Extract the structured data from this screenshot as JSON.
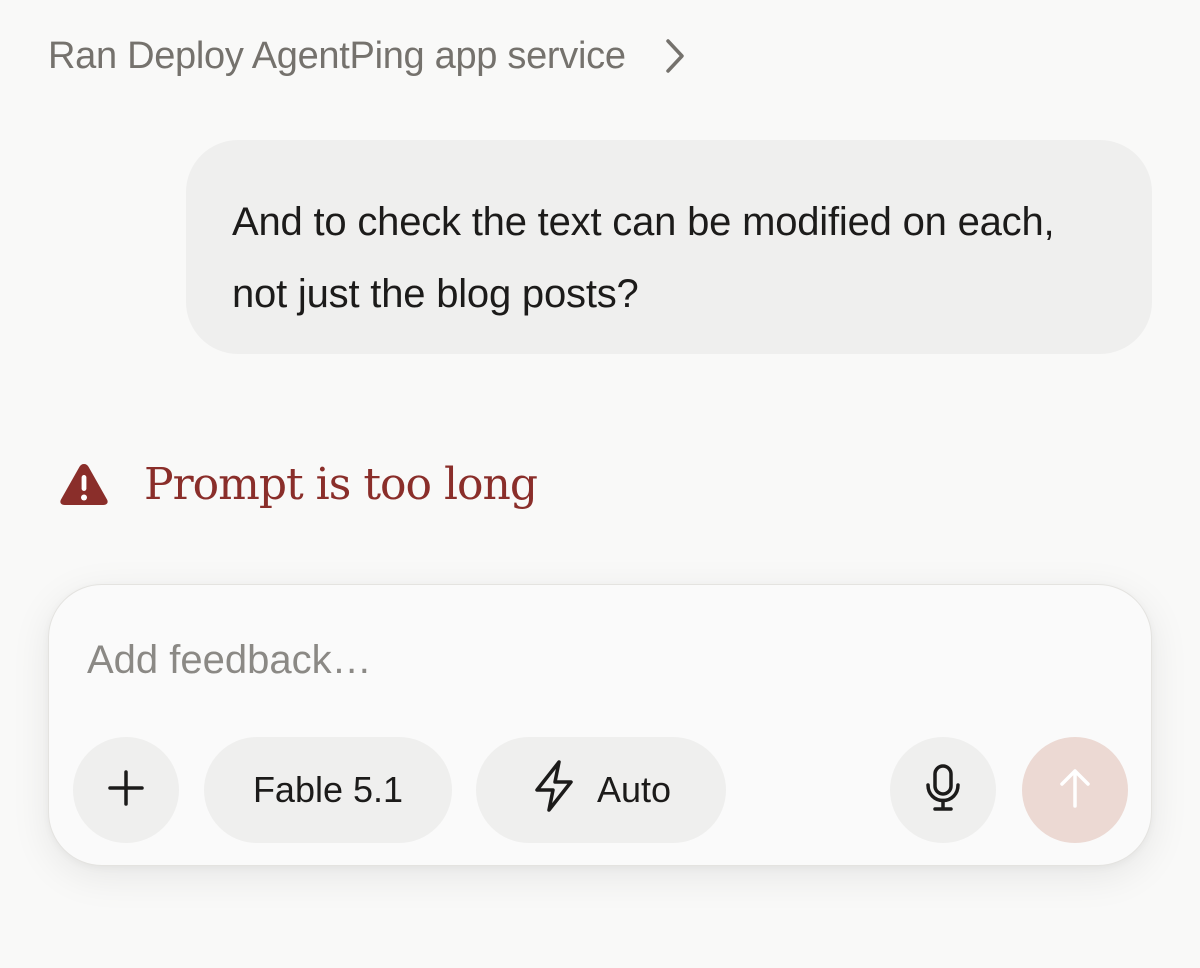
{
  "tool_call": {
    "label": "Ran Deploy AgentPing app service",
    "icon": "chevron-right-icon"
  },
  "user_message": {
    "text": "And to check the text can be modified on each, not just the blog posts?"
  },
  "error": {
    "icon": "warning-triangle-icon",
    "text": "Prompt is too long",
    "color": "#8a2e2a"
  },
  "composer": {
    "placeholder": "Add feedback…",
    "value": "",
    "buttons": {
      "add_icon": "plus-icon",
      "model_label": "Fable 5.1",
      "mode_icon": "lightning-icon",
      "mode_label": "Auto",
      "mic_icon": "microphone-icon",
      "send_icon": "arrow-up-icon",
      "send_color": "#ecd9d3"
    }
  }
}
